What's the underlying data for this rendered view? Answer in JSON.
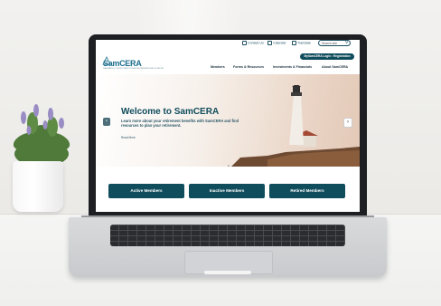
{
  "website": {
    "utility": {
      "contact": "Contact Us",
      "calendar": "Calendar",
      "translate": "Translate",
      "search_placeholder": "Search site"
    },
    "logo": {
      "name": "SamCERA",
      "tagline": "SAN MATEO COUNTY EMPLOYEES' RETIREMENT ASSOCIATION"
    },
    "login_button": "MySamCERA Login • Registration",
    "nav": [
      "Members",
      "Forms & Resources",
      "Investments & Financials",
      "About SamCERA"
    ],
    "hero": {
      "title": "Welcome to SamCERA",
      "subtitle": "Learn more about your retirement benefits with SamCERA and find resources to plan your retirement.",
      "read_more": "Read More"
    },
    "carousel": {
      "prev": "‹",
      "next": "›",
      "pause": "II"
    },
    "member_buttons": [
      "Active Members",
      "Inactive Members",
      "Retired Members"
    ]
  },
  "colors": {
    "brand": "#0f4c5c",
    "logo": "#1b6e8c",
    "hero_warm": "#e3c9b7"
  }
}
